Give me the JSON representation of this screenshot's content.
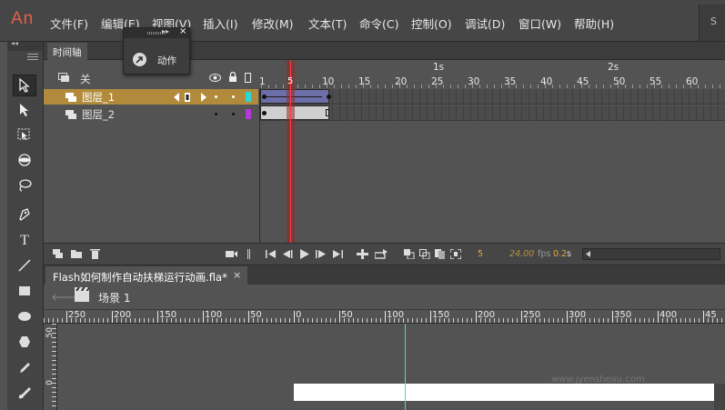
{
  "app": {
    "logo": "An"
  },
  "menu": [
    "文件(F)",
    "编辑(E)",
    "视图(V)",
    "插入(I)",
    "修改(M)",
    "文本(T)",
    "命令(C)",
    "控制(O)",
    "调试(D)",
    "窗口(W)",
    "帮助(H)"
  ],
  "menubar_right": {
    "label": "S"
  },
  "toolbar": {
    "collapse_label": "◂◂",
    "tools": [
      "selection-tool",
      "subselection-tool",
      "free-transform-tool",
      "3d-rotation-tool",
      "lasso-tool",
      "pen-tool",
      "text-tool",
      "line-tool",
      "rectangle-tool",
      "oval-tool",
      "polystar-tool",
      "pencil-tool",
      "brush-tool"
    ],
    "text_tool_glyph": "T"
  },
  "actions_popup": {
    "label": "动作",
    "collapse": "▸▸",
    "close": "×"
  },
  "timeline": {
    "tab_label": "时间轴",
    "layers_header": {
      "label": "关"
    },
    "layers": [
      {
        "name": "图层_1",
        "color": "#2ed6d0",
        "selected": true
      },
      {
        "name": "图层_2",
        "color": "#b23bd3",
        "selected": false
      }
    ],
    "frame_numbers": [
      "1",
      "5",
      "10",
      "15",
      "20",
      "25",
      "30",
      "35",
      "40",
      "45",
      "50",
      "55",
      "60"
    ],
    "seconds": [
      "1s",
      "2s"
    ],
    "playhead_frame": "5",
    "status": {
      "frame": "5",
      "fps": "24.00",
      "fps_unit": "fps",
      "time": "0.2",
      "time_unit": "s"
    }
  },
  "document": {
    "tab_title": "Flash如何制作自动扶梯运行动画.fla*",
    "tab_close": "×",
    "scene_label": "场景 1"
  },
  "ruler": {
    "h_labels": [
      "250",
      "200",
      "150",
      "100",
      "50",
      "0",
      "50",
      "100",
      "150",
      "200",
      "250",
      "300",
      "350",
      "400",
      "45"
    ],
    "v_labels": [
      "50",
      "0"
    ]
  },
  "watermark": "www.jyensheau.com",
  "colors": {
    "accent": "#b28a3c",
    "logo": "#e0604a",
    "playhead": "#ff4040",
    "frame_status": "#e3a63a",
    "guide": "#49d6d6"
  }
}
